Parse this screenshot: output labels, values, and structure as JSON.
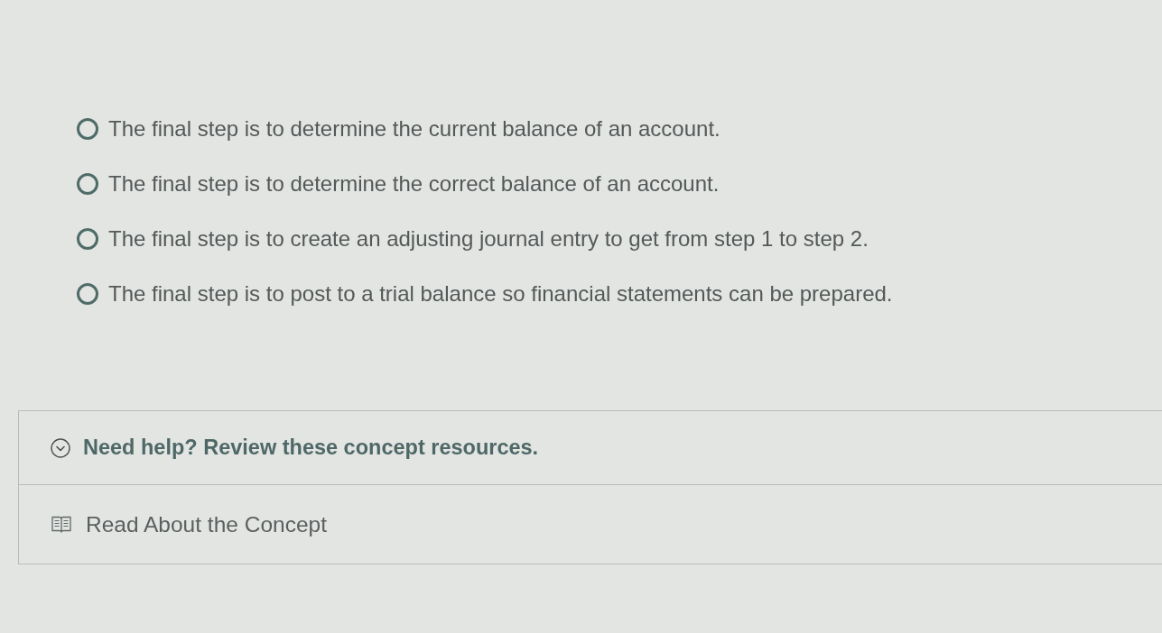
{
  "options": [
    {
      "text": "The final step is to determine the current balance of an account.",
      "selected": false
    },
    {
      "text": "The final step is to determine the correct balance of an account.",
      "selected": false
    },
    {
      "text": "The final step is to create an adjusting journal entry to get from step 1 to step 2.",
      "selected": false
    },
    {
      "text": "The final step is to post to a trial balance so financial statements can be prepared.",
      "selected": false
    }
  ],
  "help": {
    "title": "Need help? Review these concept resources.",
    "expanded": true,
    "resources": [
      {
        "label": "Read About the Concept"
      }
    ]
  }
}
